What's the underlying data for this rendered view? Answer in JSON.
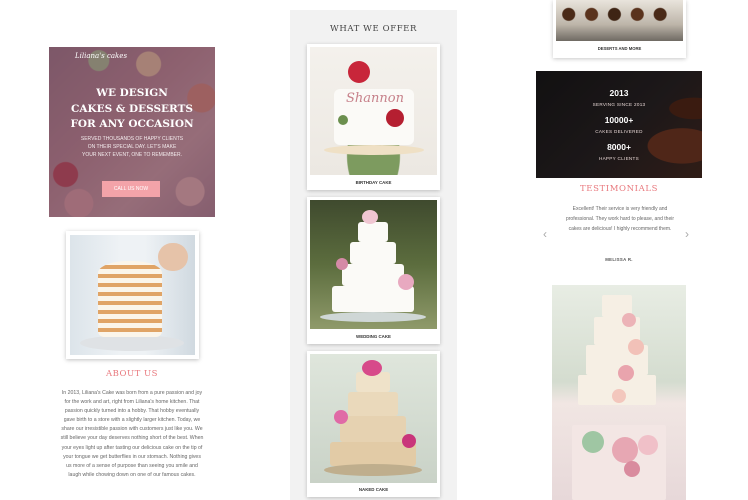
{
  "hero": {
    "logo": "Liliana's cakes",
    "title_line1": "WE DESIGN",
    "title_line2": "CAKES & DESSERTS",
    "title_line3": "FOR ANY OCCASION",
    "text_line1": "SERVED THOUSANDS OF HAPPY CLIENTS",
    "text_line2": "ON THEIR SPECIAL DAY. LET'S MAKE",
    "text_line3": "YOUR NEXT EVENT, ONE TO REMEMBER.",
    "cta": "CALL US NOW"
  },
  "about": {
    "heading": "ABOUT US",
    "text": "In 2013, Liliana's Cake was born from a pure passion and joy for the work and art, right from Liliana's home kitchen. That passion quickly turned into a hobby. That hobby eventually gave birth to a store with a slightly larger kitchen. Today, we share our irresistible passion with customers just like you. We still believe your day deserves nothing short of the best. When your eyes light up after tasting our delicious cake on the tip of your tongue we get butterflies in our stomach. Nothing gives us more of a sense of purpose than seeing you smile and laugh while chowing down on one of our famous cakes."
  },
  "offer": {
    "heading": "WHAT WE OFFER",
    "items": [
      {
        "caption": "BIRTHDAY CAKE",
        "cake_script": "Shannon"
      },
      {
        "caption": "WEDDING CAKE"
      },
      {
        "caption": "NAKED CAKE"
      }
    ]
  },
  "desserts": {
    "caption": "DESERTS AND MORE"
  },
  "stats": {
    "year": "2013",
    "year_label": "SERVING SINCE 2013",
    "cakes": "10000+",
    "cakes_label": "CAKES DELIVERED",
    "clients": "8000+",
    "clients_label": "HAPPY CLIENTS"
  },
  "testimonials": {
    "heading": "TESTIMONIALS",
    "quote": "Excellent! Their service is very friendly and professional. They work hard to please, and their cakes are delicious! I highly recommend them.",
    "author": "MELISSA R.",
    "prev_icon": "chevron-left-icon",
    "next_icon": "chevron-right-icon"
  },
  "colors": {
    "accent": "#e97a7f",
    "button": "#f3a3a9",
    "panel": "#f2f2f2"
  }
}
